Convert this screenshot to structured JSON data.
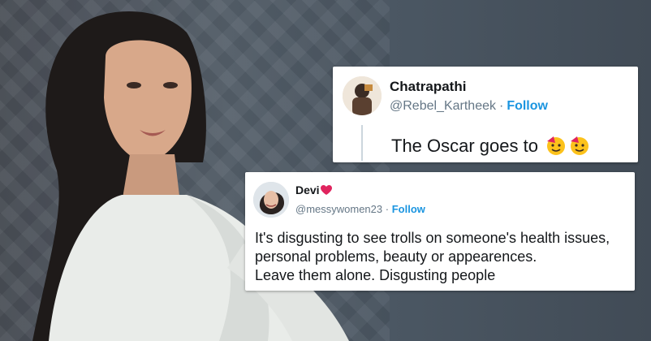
{
  "tweet1": {
    "name": "Chatrapathi",
    "handle": "@Rebel_Kartheek",
    "separator": "·",
    "follow_label": "Follow",
    "text": "The Oscar goes to",
    "emoji": [
      "partying-face-icon",
      "partying-face-icon"
    ]
  },
  "tweet2": {
    "name": "Devi",
    "name_emoji": "heart-icon",
    "handle": "@messywomen23",
    "separator": "·",
    "follow_label": "Follow",
    "lines": [
      "It's disgusting to see trolls on someone's health issues,",
      "personal problems, beauty or appearences.",
      "Leave them alone. Disgusting people"
    ]
  },
  "colors": {
    "follow": "#1b95e0",
    "text": "#14171a",
    "secondary": "#657786",
    "heart": "#e0245e"
  }
}
